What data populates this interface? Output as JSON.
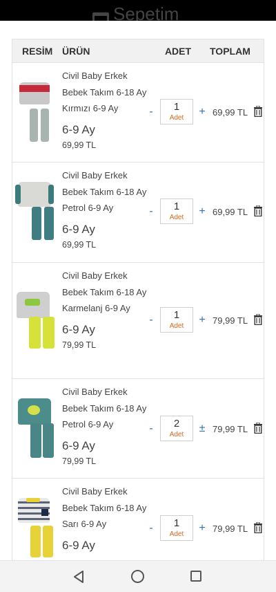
{
  "header": {
    "title": "Sepetim"
  },
  "columns": {
    "image": "RESİM",
    "product": "ÜRÜN",
    "qty": "ADET",
    "total": "TOPLAM"
  },
  "qty_unit": "Adet",
  "items": [
    {
      "name": "Civil Baby Erkek Bebek Takım 6-18 Ay Kırmızı 6-9 Ay",
      "size": "6-9 Ay",
      "price": "69,99 TL",
      "qty": "1",
      "total": "69,99 TL",
      "plus": "+",
      "colors": {
        "top": "#c8c8c8",
        "accent": "#c62a3a",
        "bottom": "#a7b4b0"
      }
    },
    {
      "name": "Civil Baby Erkek Bebek Takım 6-18 Ay Petrol 6-9 Ay",
      "size": "6-9 Ay",
      "price": "69,99 TL",
      "qty": "1",
      "total": "69,99 TL",
      "plus": "+",
      "colors": {
        "top": "#d9d9d6",
        "accent": "#3d7a7c",
        "bottom": "#3f7d83"
      }
    },
    {
      "name": "Civil Baby Erkek Bebek Takım 6-18 Ay Karmelanj 6-9 Ay",
      "size": "6-9 Ay",
      "price": "79,99 TL",
      "qty": "1",
      "total": "79,99 TL",
      "plus": "+",
      "colors": {
        "top": "#cfcfcf",
        "accent": "#8dc63f",
        "bottom": "#d6e23a"
      }
    },
    {
      "name": "Civil Baby Erkek Bebek Takım 6-18 Ay Petrol 6-9 Ay",
      "size": "6-9 Ay",
      "price": "79,99 TL",
      "qty": "2",
      "total": "79,99 TL",
      "plus": "±",
      "colors": {
        "top": "#4c8c8a",
        "accent": "#d4e04a",
        "bottom": "#4a8688"
      }
    },
    {
      "name": "Civil Baby Erkek Bebek Takım 6-18 Ay Sarı 6-9 Ay",
      "size": "6-9 Ay",
      "price": "",
      "qty": "1",
      "total": "79,99 TL",
      "plus": "+",
      "colors": {
        "top": "#e9e9ea",
        "accent": "#1f2a44",
        "bottom": "#e7d23a"
      }
    }
  ]
}
